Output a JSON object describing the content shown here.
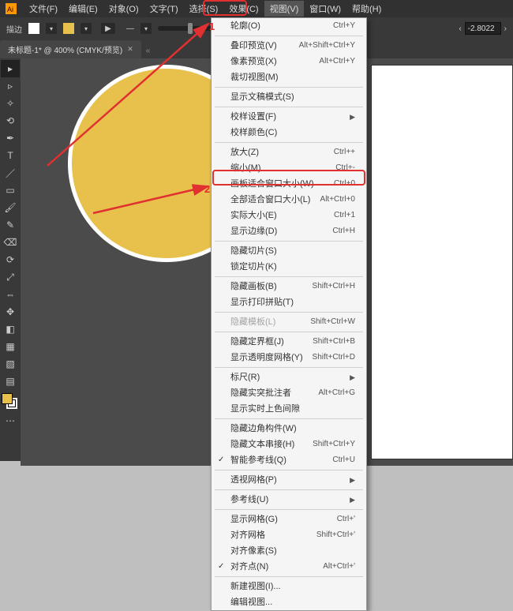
{
  "menubar": {
    "items": [
      "文件(F)",
      "编辑(E)",
      "对象(O)",
      "文字(T)",
      "选择(S)",
      "效果(C)",
      "视图(V)",
      "窗口(W)",
      "帮助(H)"
    ]
  },
  "optbar": {
    "stroke_label": "描边",
    "opacity_value": "-2.8022"
  },
  "tab": {
    "title": "未标题-1* @ 400% (CMYK/预览)"
  },
  "dropdown": {
    "groups": [
      [
        {
          "label": "轮廓(O)",
          "shortcut": "Ctrl+Y"
        }
      ],
      [
        {
          "label": "叠印预览(V)",
          "shortcut": "Alt+Shift+Ctrl+Y"
        },
        {
          "label": "像素预览(X)",
          "shortcut": "Alt+Ctrl+Y"
        },
        {
          "label": "裁切视图(M)"
        }
      ],
      [
        {
          "label": "显示文稿模式(S)"
        }
      ],
      [
        {
          "label": "校样设置(F)",
          "arrow": true
        },
        {
          "label": "校样颜色(C)"
        }
      ],
      [
        {
          "label": "放大(Z)",
          "shortcut": "Ctrl++"
        },
        {
          "label": "缩小(M)",
          "shortcut": "Ctrl+-"
        },
        {
          "label": "画板适合窗口大小(W)",
          "shortcut": "Ctrl+0"
        },
        {
          "label": "全部适合窗口大小(L)",
          "shortcut": "Alt+Ctrl+0"
        },
        {
          "label": "实际大小(E)",
          "shortcut": "Ctrl+1"
        },
        {
          "label": "显示边缘(D)",
          "shortcut": "Ctrl+H"
        }
      ],
      [
        {
          "label": "隐藏切片(S)"
        },
        {
          "label": "锁定切片(K)"
        }
      ],
      [
        {
          "label": "隐藏画板(B)",
          "shortcut": "Shift+Ctrl+H"
        },
        {
          "label": "显示打印拼贴(T)"
        }
      ],
      [
        {
          "label": "隐藏模板(L)",
          "shortcut": "Shift+Ctrl+W",
          "disabled": true
        }
      ],
      [
        {
          "label": "隐藏定界框(J)",
          "shortcut": "Shift+Ctrl+B"
        },
        {
          "label": "显示透明度网格(Y)",
          "shortcut": "Shift+Ctrl+D"
        }
      ],
      [
        {
          "label": "标尺(R)",
          "arrow": true
        },
        {
          "label": "隐藏实突批注者",
          "shortcut": "Alt+Ctrl+G"
        },
        {
          "label": "显示实时上色间隙"
        }
      ],
      [
        {
          "label": "隐藏边角构件(W)"
        },
        {
          "label": "隐藏文本串接(H)",
          "shortcut": "Shift+Ctrl+Y"
        },
        {
          "label": "智能参考线(Q)",
          "shortcut": "Ctrl+U",
          "check": true
        }
      ],
      [
        {
          "label": "透视网格(P)",
          "arrow": true
        }
      ],
      [
        {
          "label": "参考线(U)",
          "arrow": true
        }
      ],
      [
        {
          "label": "显示网格(G)",
          "shortcut": "Ctrl+'"
        },
        {
          "label": "对齐网格",
          "shortcut": "Shift+Ctrl+'"
        },
        {
          "label": "对齐像素(S)"
        },
        {
          "label": "对齐点(N)",
          "shortcut": "Alt+Ctrl+'",
          "check": true
        }
      ],
      [
        {
          "label": "新建视图(I)..."
        },
        {
          "label": "编辑视图..."
        }
      ]
    ]
  },
  "annotations": {
    "num1": "1",
    "num2": "2"
  }
}
